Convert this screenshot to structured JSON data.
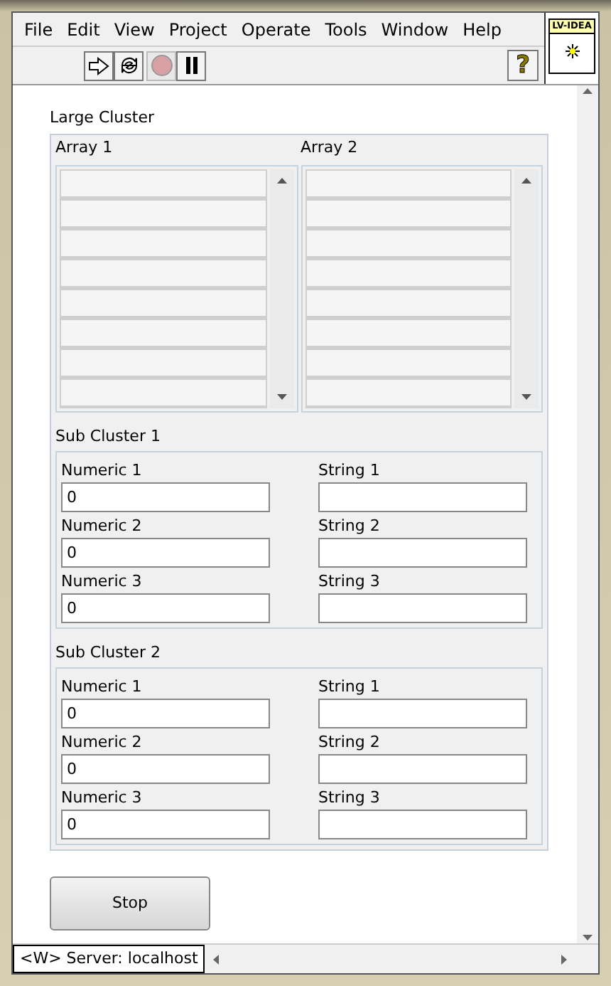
{
  "menu": [
    "File",
    "Edit",
    "View",
    "Project",
    "Operate",
    "Tools",
    "Window",
    "Help"
  ],
  "toolbar": [
    {
      "kind": "run"
    },
    {
      "kind": "run-continuous"
    },
    {
      "kind": "abort"
    },
    {
      "kind": "pause"
    }
  ],
  "help_button": {
    "label": "?"
  },
  "icon_pane": {
    "label": "LV-IDEA"
  },
  "large_cluster": {
    "label": "Large Cluster",
    "arrays": [
      {
        "label": "Array 1"
      },
      {
        "label": "Array 2"
      }
    ],
    "sub_clusters": [
      {
        "label": "Sub Cluster 1",
        "numerics": [
          {
            "label": "Numeric 1",
            "value": "0"
          },
          {
            "label": "Numeric 2",
            "value": "0"
          },
          {
            "label": "Numeric 3",
            "value": "0"
          }
        ],
        "strings": [
          {
            "label": "String 1"
          },
          {
            "label": "String 2"
          },
          {
            "label": "String 3"
          }
        ]
      },
      {
        "label": "Sub Cluster 2",
        "numerics": [
          {
            "label": "Numeric 1",
            "value": "0"
          },
          {
            "label": "Numeric 2",
            "value": "0"
          },
          {
            "label": "Numeric 3",
            "value": "0"
          }
        ],
        "strings": [
          {
            "label": "String 1"
          },
          {
            "label": "String 2"
          },
          {
            "label": "String 3"
          }
        ]
      }
    ]
  },
  "stop_button": {
    "label": "Stop"
  },
  "status_bar": {
    "text": "<W> Server: localhost"
  }
}
